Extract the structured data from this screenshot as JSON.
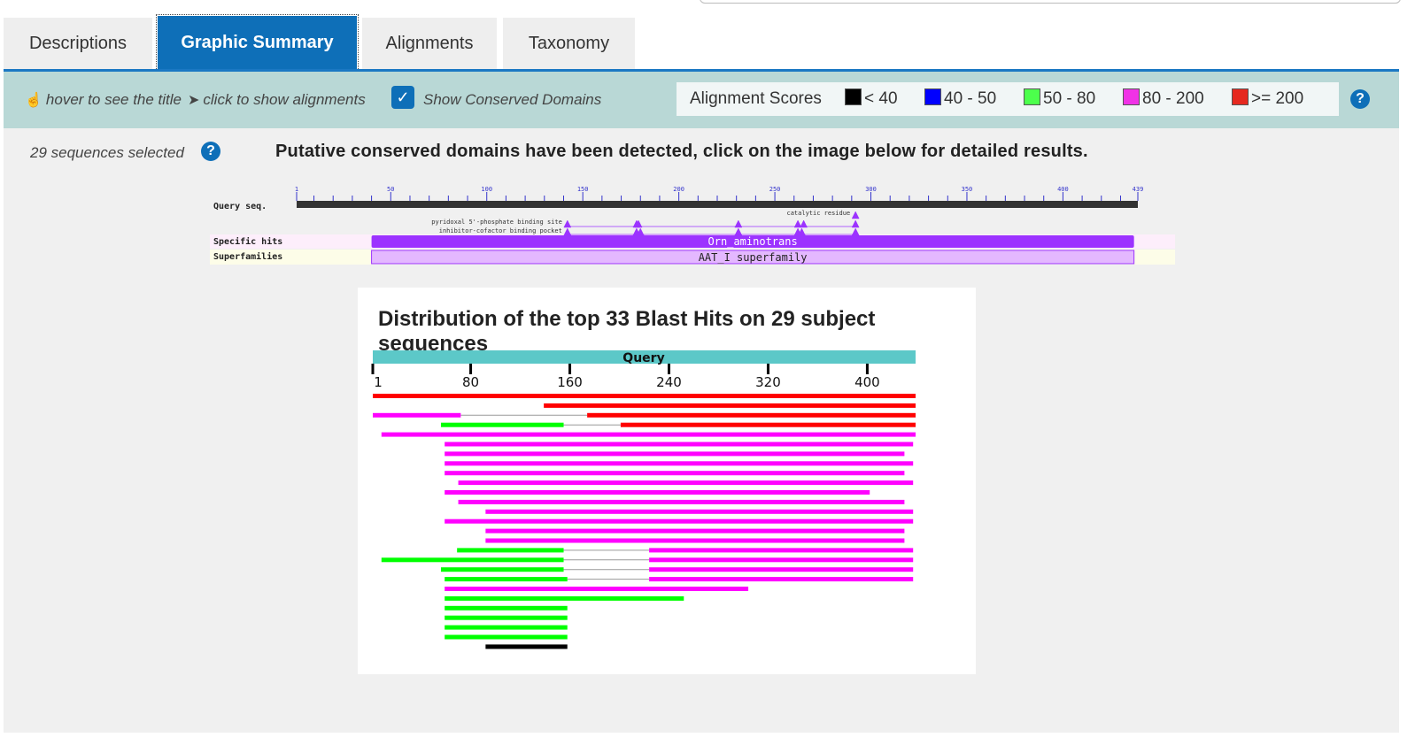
{
  "tabs": [
    {
      "label": "Descriptions",
      "active": false
    },
    {
      "label": "Graphic Summary",
      "active": true
    },
    {
      "label": "Alignments",
      "active": false
    },
    {
      "label": "Taxonomy",
      "active": false
    }
  ],
  "toolbar": {
    "hover_hint": "hover to see the title",
    "click_hint": "click to show alignments",
    "show_cdd_label": "Show Conserved Domains",
    "show_cdd_checked": true
  },
  "legend": {
    "title": "Alignment Scores",
    "items": [
      {
        "label": "< 40",
        "color": "#000000"
      },
      {
        "label": "40 - 50",
        "color": "#0000ff"
      },
      {
        "label": "50 - 80",
        "color": "#4cff4c"
      },
      {
        "label": "80 - 200",
        "color": "#f032e6"
      },
      {
        "label": ">= 200",
        "color": "#e6291f"
      }
    ]
  },
  "selection": {
    "text": "29 sequences selected"
  },
  "cd_message": "Putative conserved domains have been detected, click on the image below for detailed results.",
  "cdd": {
    "query_label": "Query seq.",
    "ticks": [
      "1",
      "50",
      "100",
      "150",
      "200",
      "250",
      "300",
      "350",
      "400",
      "439"
    ],
    "query_length": 439,
    "site_labels": {
      "catalytic": "catalytic residue",
      "pyridoxal": "pyridoxal 5'-phosphate binding site",
      "inhibitor": "inhibitor-cofactor binding pocket"
    },
    "row_labels": {
      "specific": "Specific hits",
      "super": "Superfamilies"
    },
    "specific_hit": {
      "label": "Orn_aminotrans",
      "start": 40,
      "end": 437
    },
    "superfamily": {
      "label": "AAT_I superfamily",
      "start": 40,
      "end": 437
    },
    "catalytic_sites": [
      292
    ],
    "pyridoxal_sites": [
      142,
      178,
      179,
      231,
      262,
      265,
      292
    ],
    "inhibitor_sites": [
      142,
      178,
      180,
      231,
      262,
      264,
      292
    ],
    "colors": {
      "hit": "#9c33ff",
      "super": "#e4b8ff",
      "site": "#9c33ff"
    }
  },
  "distribution": {
    "title": "Distribution of the top 33 Blast Hits on 29 subject sequences",
    "query_label": "Query",
    "query_length": 439,
    "ticks": [
      "1",
      "80",
      "160",
      "240",
      "320",
      "400"
    ],
    "colors": {
      "red": "#ff0000",
      "magenta": "#ff00ff",
      "green": "#00ff00",
      "black": "#000000",
      "query": "#5cc8c8",
      "connector": "#999999"
    },
    "hits": [
      {
        "segments": [
          {
            "start": 1,
            "end": 439,
            "color": "red"
          }
        ]
      },
      {
        "segments": [
          {
            "start": 139,
            "end": 439,
            "color": "red"
          }
        ]
      },
      {
        "segments": [
          {
            "start": 1,
            "end": 72,
            "color": "magenta"
          },
          {
            "start": 174,
            "end": 439,
            "color": "red"
          }
        ]
      },
      {
        "segments": [
          {
            "start": 56,
            "end": 155,
            "color": "green"
          },
          {
            "start": 201,
            "end": 439,
            "color": "red"
          }
        ]
      },
      {
        "segments": [
          {
            "start": 8,
            "end": 439,
            "color": "magenta"
          }
        ]
      },
      {
        "segments": [
          {
            "start": 59,
            "end": 437,
            "color": "magenta"
          }
        ]
      },
      {
        "segments": [
          {
            "start": 59,
            "end": 430,
            "color": "magenta"
          }
        ]
      },
      {
        "segments": [
          {
            "start": 59,
            "end": 437,
            "color": "magenta"
          }
        ]
      },
      {
        "segments": [
          {
            "start": 59,
            "end": 430,
            "color": "magenta"
          }
        ]
      },
      {
        "segments": [
          {
            "start": 70,
            "end": 437,
            "color": "magenta"
          }
        ]
      },
      {
        "segments": [
          {
            "start": 59,
            "end": 402,
            "color": "magenta"
          }
        ]
      },
      {
        "segments": [
          {
            "start": 70,
            "end": 430,
            "color": "magenta"
          }
        ]
      },
      {
        "segments": [
          {
            "start": 92,
            "end": 437,
            "color": "magenta"
          }
        ]
      },
      {
        "segments": [
          {
            "start": 59,
            "end": 437,
            "color": "magenta"
          }
        ]
      },
      {
        "segments": [
          {
            "start": 92,
            "end": 430,
            "color": "magenta"
          }
        ]
      },
      {
        "segments": [
          {
            "start": 92,
            "end": 430,
            "color": "magenta"
          }
        ]
      },
      {
        "segments": [
          {
            "start": 69,
            "end": 155,
            "color": "green"
          },
          {
            "start": 224,
            "end": 437,
            "color": "magenta"
          }
        ]
      },
      {
        "segments": [
          {
            "start": 8,
            "end": 155,
            "color": "green"
          },
          {
            "start": 224,
            "end": 437,
            "color": "magenta"
          }
        ]
      },
      {
        "segments": [
          {
            "start": 56,
            "end": 155,
            "color": "green"
          },
          {
            "start": 224,
            "end": 437,
            "color": "magenta"
          }
        ]
      },
      {
        "segments": [
          {
            "start": 59,
            "end": 158,
            "color": "green"
          },
          {
            "start": 224,
            "end": 437,
            "color": "magenta"
          }
        ]
      },
      {
        "segments": [
          {
            "start": 59,
            "end": 304,
            "color": "magenta"
          }
        ]
      },
      {
        "segments": [
          {
            "start": 59,
            "end": 252,
            "color": "green"
          }
        ]
      },
      {
        "segments": [
          {
            "start": 59,
            "end": 158,
            "color": "green"
          }
        ]
      },
      {
        "segments": [
          {
            "start": 59,
            "end": 158,
            "color": "green"
          }
        ]
      },
      {
        "segments": [
          {
            "start": 59,
            "end": 158,
            "color": "green"
          }
        ]
      },
      {
        "segments": [
          {
            "start": 59,
            "end": 158,
            "color": "green"
          }
        ]
      },
      {
        "segments": [
          {
            "start": 92,
            "end": 158,
            "color": "black"
          }
        ]
      }
    ]
  }
}
